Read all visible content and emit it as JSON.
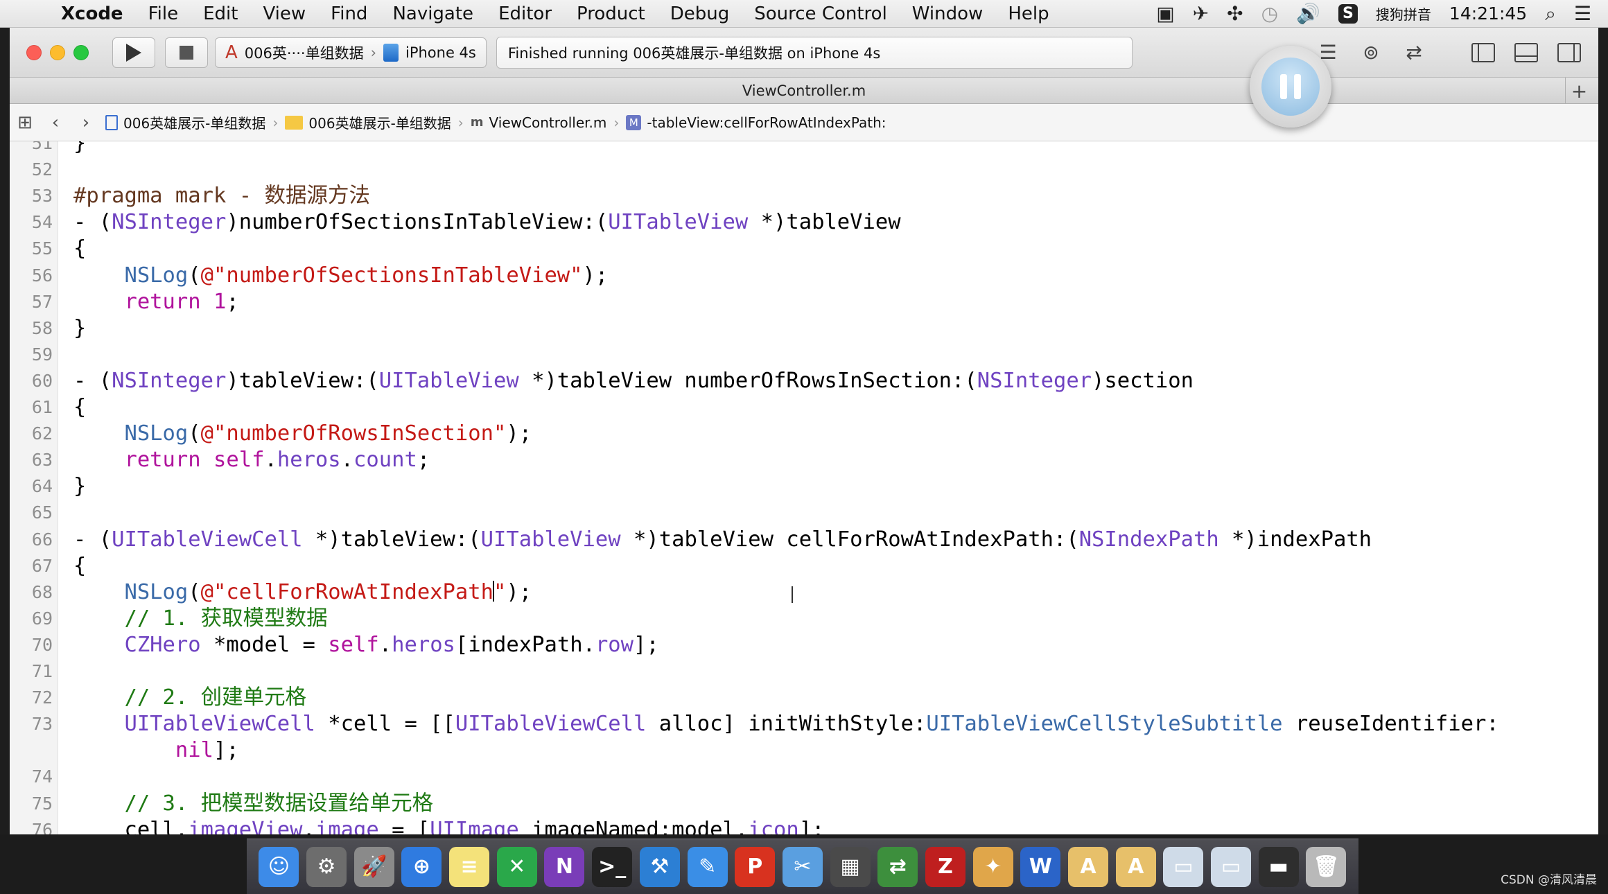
{
  "menubar": {
    "apple": "",
    "app": "Xcode",
    "items": [
      "File",
      "Edit",
      "View",
      "Find",
      "Navigate",
      "Editor",
      "Product",
      "Debug",
      "Source Control",
      "Window",
      "Help"
    ],
    "ime": "搜狗拼音",
    "ime_badge": "S",
    "clock": "14:21:45"
  },
  "toolbar": {
    "scheme": "006英····单组数据",
    "device": "iPhone 4s",
    "activity": "Finished running 006英雄展示-单组数据 on iPhone 4s"
  },
  "tab": {
    "title": "ViewController.m",
    "add": "+"
  },
  "jumpbar": {
    "project": "006英雄展示-单组数据",
    "group": "006英雄展示-单组数据",
    "file_prefix": "m",
    "file": "ViewController.m",
    "method_prefix": "M",
    "method": "-tableView:cellForRowAtIndexPath:"
  },
  "editor": {
    "lines": [
      {
        "n": "51",
        "text": "}"
      },
      {
        "n": "52",
        "text": ""
      },
      {
        "n": "53",
        "text": "#pragma mark - 数据源方法"
      },
      {
        "n": "54",
        "text": "- (NSInteger)numberOfSectionsInTableView:(UITableView *)tableView"
      },
      {
        "n": "55",
        "text": "{"
      },
      {
        "n": "56",
        "text": "    NSLog(@\"numberOfSectionsInTableView\");"
      },
      {
        "n": "57",
        "text": "    return 1;"
      },
      {
        "n": "58",
        "text": "}"
      },
      {
        "n": "59",
        "text": ""
      },
      {
        "n": "60",
        "text": "- (NSInteger)tableView:(UITableView *)tableView numberOfRowsInSection:(NSInteger)section"
      },
      {
        "n": "61",
        "text": "{"
      },
      {
        "n": "62",
        "text": "    NSLog(@\"numberOfRowsInSection\");"
      },
      {
        "n": "63",
        "text": "    return self.heros.count;"
      },
      {
        "n": "64",
        "text": "}"
      },
      {
        "n": "65",
        "text": ""
      },
      {
        "n": "66",
        "text": "- (UITableViewCell *)tableView:(UITableView *)tableView cellForRowAtIndexPath:(NSIndexPath *)indexPath"
      },
      {
        "n": "67",
        "text": "{"
      },
      {
        "n": "68",
        "text": "    NSLog(@\"cellForRowAtIndexPath\");"
      },
      {
        "n": "69",
        "text": "    // 1. 获取模型数据"
      },
      {
        "n": "70",
        "text": "    CZHero *model = self.heros[indexPath.row];"
      },
      {
        "n": "71",
        "text": ""
      },
      {
        "n": "72",
        "text": "    // 2. 创建单元格"
      },
      {
        "n": "73",
        "text": "    UITableViewCell *cell = [[UITableViewCell alloc] initWithStyle:UITableViewCellStyleSubtitle reuseIdentifier:"
      },
      {
        "n": "",
        "text": "        nil];"
      },
      {
        "n": "74",
        "text": ""
      },
      {
        "n": "75",
        "text": "    // 3. 把模型数据设置给单元格"
      },
      {
        "n": "76",
        "text": "    cell.imageView.image = [UIImage imageNamed:model.icon];"
      }
    ]
  },
  "dock": {
    "icons": [
      {
        "name": "finder-icon",
        "glyph": "☺",
        "color": "#3d8be8"
      },
      {
        "name": "system-preferences-icon",
        "glyph": "⚙",
        "color": "#6d6d6d"
      },
      {
        "name": "launchpad-icon",
        "glyph": "🚀",
        "color": "#8a8a8a"
      },
      {
        "name": "safari-icon",
        "glyph": "⊕",
        "color": "#2f7be0"
      },
      {
        "name": "notes-icon",
        "glyph": "≡",
        "color": "#f4e27a"
      },
      {
        "name": "xmind-icon",
        "glyph": "✕",
        "color": "#2aa84a"
      },
      {
        "name": "onenote-icon",
        "glyph": "N",
        "color": "#7a3db8"
      },
      {
        "name": "terminal-icon",
        "glyph": ">_",
        "color": "#222222"
      },
      {
        "name": "xcode-icon",
        "glyph": "⚒",
        "color": "#2c7fd4"
      },
      {
        "name": "instruments-icon",
        "glyph": "✎",
        "color": "#3a8ee6"
      },
      {
        "name": "pdf-reader-icon",
        "glyph": "P",
        "color": "#d8321f"
      },
      {
        "name": "screenshot-tool-icon",
        "glyph": "✂",
        "color": "#5a9fe0"
      },
      {
        "name": "movie-maker-icon",
        "glyph": "▦",
        "color": "#4a4a4a"
      },
      {
        "name": "ftp-client-icon",
        "glyph": "⇄",
        "color": "#3d8f3d"
      },
      {
        "name": "filezilla-icon",
        "glyph": "Z",
        "color": "#bf1f1f"
      },
      {
        "name": "app-icon-blue",
        "glyph": "✦",
        "color": "#e0a64a"
      },
      {
        "name": "word-icon",
        "glyph": "W",
        "color": "#2b64c8"
      },
      {
        "name": "document-app-icon",
        "glyph": "A",
        "color": "#e7c06a"
      },
      {
        "name": "document-app-icon-2",
        "glyph": "A",
        "color": "#e7c06a"
      },
      {
        "name": "window-preview-icon",
        "glyph": "▭",
        "color": "#cfdbe8"
      },
      {
        "name": "window-preview-icon-2",
        "glyph": "▭",
        "color": "#cfdbe8"
      },
      {
        "name": "display-icon",
        "glyph": "▬",
        "color": "#2e2e2e"
      },
      {
        "name": "trash-icon",
        "glyph": "🗑",
        "color": "#b9b9b9"
      }
    ]
  },
  "watermark": "CSDN @清风清晨"
}
